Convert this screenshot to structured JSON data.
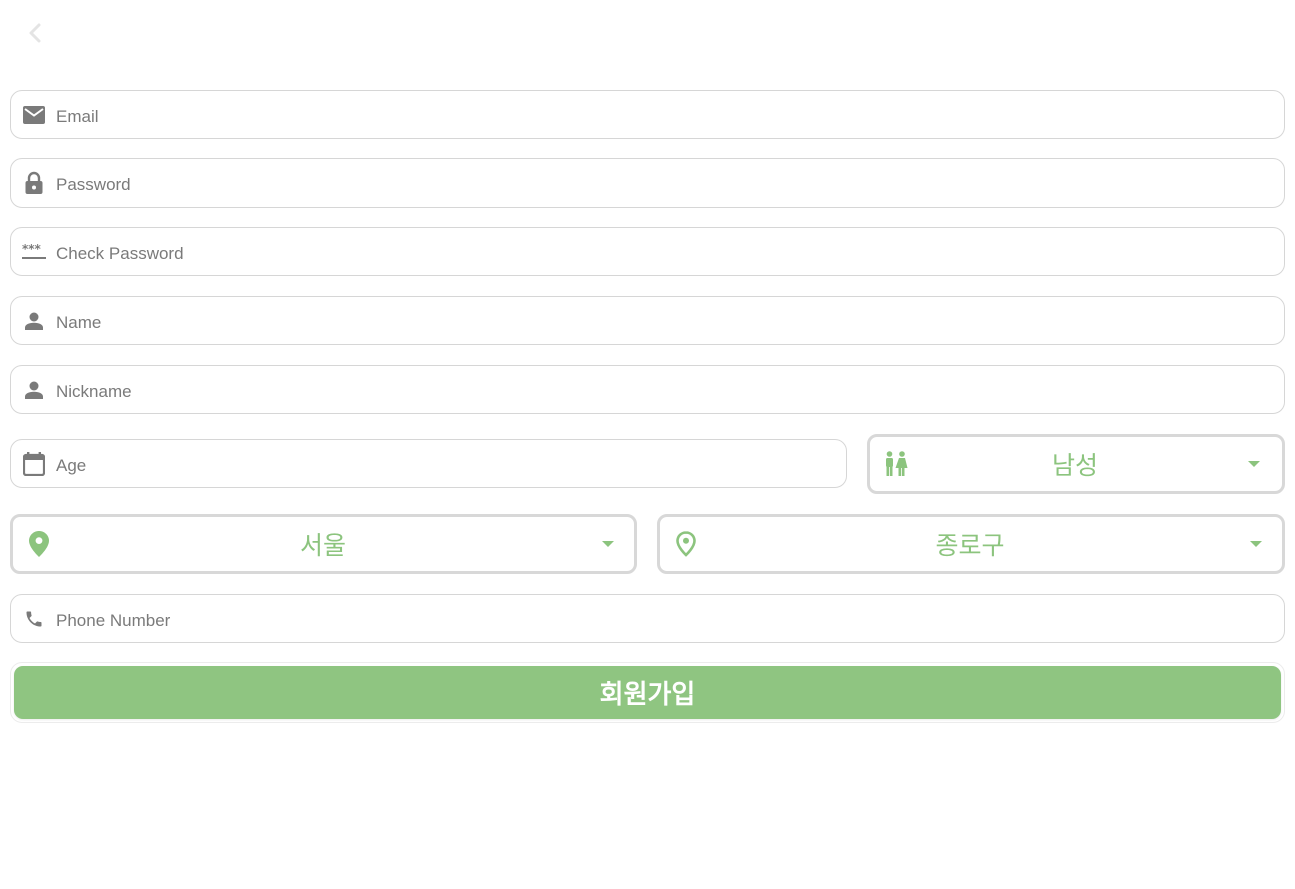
{
  "header": {
    "back_icon": "chevron-left-icon"
  },
  "form": {
    "email": {
      "placeholder": "Email",
      "icon": "mail-icon"
    },
    "password": {
      "placeholder": "Password",
      "icon": "lock-icon"
    },
    "check_password": {
      "placeholder": "Check Password",
      "icon": "password-dots-icon"
    },
    "name": {
      "placeholder": "Name",
      "icon": "person-icon"
    },
    "nickname": {
      "placeholder": "Nickname",
      "icon": "person-icon"
    },
    "age": {
      "placeholder": "Age",
      "icon": "calendar-icon"
    },
    "gender": {
      "value": "남성",
      "icon": "wc-icon"
    },
    "city": {
      "value": "서울",
      "icon": "location-pin-filled-icon"
    },
    "district": {
      "value": "종로구",
      "icon": "location-pin-outline-icon"
    },
    "phone": {
      "placeholder": "Phone Number",
      "icon": "phone-icon"
    },
    "submit_label": "회원가입"
  },
  "colors": {
    "accent": "#8fc581",
    "accent_text": "#8cc47e",
    "icon_gray": "#7a7a7a",
    "border": "#d6d6d6",
    "back_icon": "#e6e6e6"
  }
}
